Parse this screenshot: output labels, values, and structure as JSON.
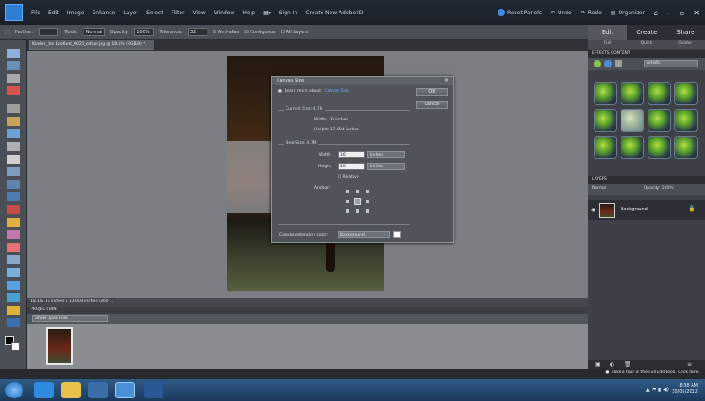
{
  "menubar": {
    "items": [
      "File",
      "Edit",
      "Image",
      "Enhance",
      "Layer",
      "Select",
      "Filter",
      "View",
      "Window",
      "Help"
    ],
    "sign_in": "Sign In",
    "create_id": "Create New Adobe ID",
    "reset_panels": "Reset Panels",
    "undo": "Undo",
    "redo": "Redo",
    "organizer": "Organizer"
  },
  "optbar": {
    "feather_label": "Feather:",
    "mode_label": "Mode:",
    "mode_value": "Normal",
    "opacity_label": "Opacity:",
    "opacity_value": "100%",
    "tolerance_label": "Tolerance:",
    "tolerance_value": "32",
    "antialias": "Anti-alias",
    "contiguous": "Contiguous",
    "all_layers": "All Layers"
  },
  "document_tab": "Kinder_the Ecofiant_0021_editor.jpg @ 18.1% (RGB/8) *",
  "dialog": {
    "title": "Canvas Size",
    "learn_text": "Learn more about:",
    "learn_link": "Canvas Size",
    "ok": "OK",
    "cancel": "Cancel",
    "current_size_title": "Current Size: 4.7M",
    "current_width": "Width: 16 inches",
    "current_height": "Height: 17.004 inches",
    "new_size_title": "New Size: 4.7M",
    "width_label": "Width:",
    "width_value": "16",
    "height_label": "Height:",
    "height_value": "20",
    "unit": "inches",
    "relative": "Relative",
    "anchor_label": "Anchor:",
    "extension_label": "Canvas extension color:",
    "extension_value": "Background"
  },
  "bin": {
    "status": "18.1%  16 inches x 13.004 inches (300 ...",
    "tab": "PROJECT BIN",
    "select": "Show Open Files"
  },
  "right_panel": {
    "tabs": [
      "Edit",
      "Create",
      "Share"
    ],
    "subtabs": [
      "Full",
      "Quick",
      "Guided"
    ],
    "effects_header": "EFFECTS   CONTENT",
    "effects_filter": "Artistic",
    "layers_header": "LAYERS",
    "blend_mode": "Normal",
    "opacity": "Opacity: 100%",
    "layer_name": "Background"
  },
  "tip": "Take a tour of the Full Edit tools. Click here.",
  "clock": {
    "time": "8:38 AM",
    "date": "30/05/2012"
  },
  "colors": {
    "accent": "#2d7fd6",
    "panel": "#3d4147",
    "canvas": "#7b7f84"
  }
}
